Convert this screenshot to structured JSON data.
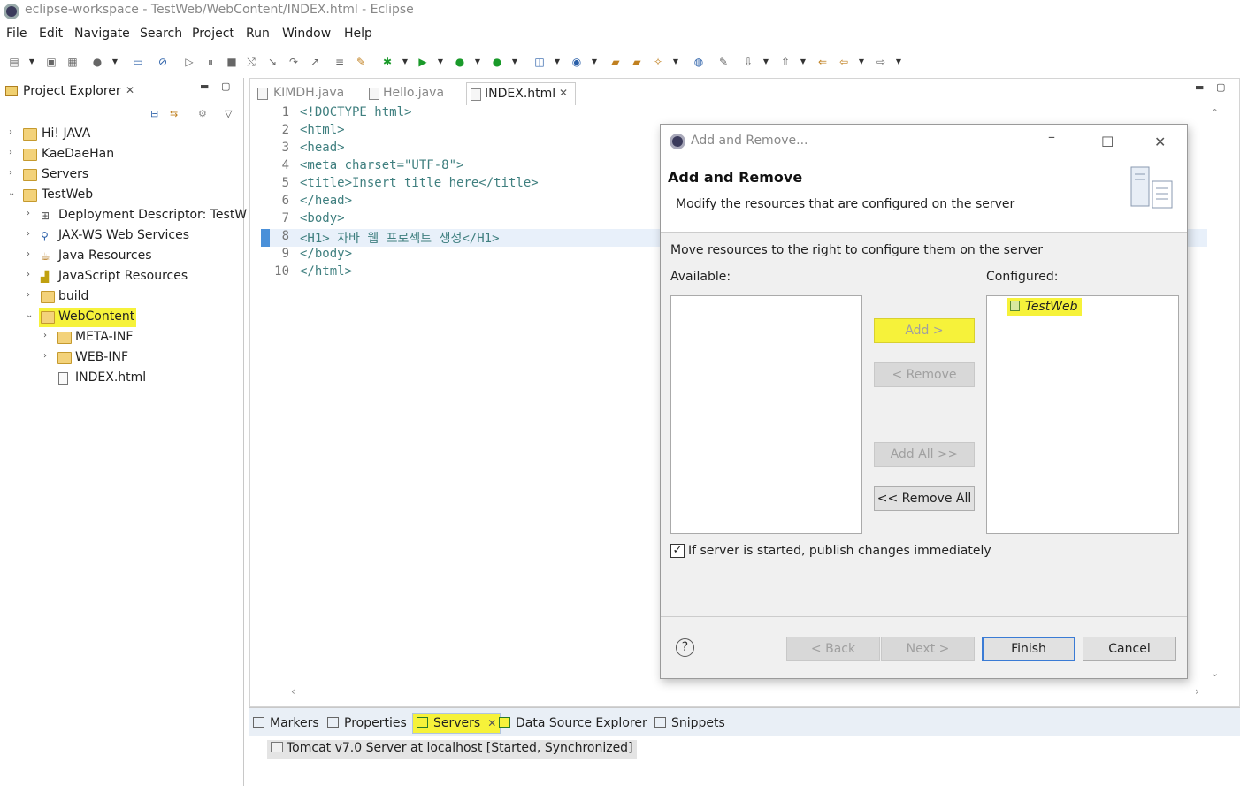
{
  "window": {
    "title": "eclipse-workspace - TestWeb/WebContent/INDEX.html - Eclipse"
  },
  "menu": [
    "File",
    "Edit",
    "Navigate",
    "Search",
    "Project",
    "Run",
    "Window",
    "Help"
  ],
  "project_explorer": {
    "title": "Project Explorer",
    "items": [
      {
        "label": "Hi! JAVA"
      },
      {
        "label": "KaeDaeHan"
      },
      {
        "label": "Servers"
      },
      {
        "label": "TestWeb"
      },
      {
        "label": "Deployment Descriptor: TestW"
      },
      {
        "label": "JAX-WS Web Services"
      },
      {
        "label": "Java Resources"
      },
      {
        "label": "JavaScript Resources"
      },
      {
        "label": "build"
      },
      {
        "label": "WebContent"
      },
      {
        "label": "META-INF"
      },
      {
        "label": "WEB-INF"
      },
      {
        "label": "INDEX.html"
      }
    ]
  },
  "editor": {
    "tabs": [
      "KIMDH.java",
      "Hello.java",
      "INDEX.html"
    ],
    "line_numbers": [
      "1",
      "2",
      "3",
      "4",
      "5",
      "6",
      "7",
      "8",
      "9",
      "10"
    ],
    "lines": [
      "<!DOCTYPE html>",
      "<html>",
      "<head>",
      "<meta charset=\"UTF-8\">",
      "<title>Insert title here</title>",
      "</head>",
      "<body>",
      "<H1> 자바 웹 프로젝트 생성</H1>",
      "</body>",
      "</html>"
    ]
  },
  "bottom": {
    "tabs": [
      "Markers",
      "Properties",
      "Servers",
      "Data Source Explorer",
      "Snippets"
    ],
    "server_entry": "Tomcat v7.0 Server at localhost   [Started, Synchronized]"
  },
  "dialog": {
    "title": "Add and Remove...",
    "heading": "Add and Remove",
    "description": "Modify the resources that are configured on the server",
    "instruction": "Move resources to the right to configure them on the server",
    "available_label": "Available:",
    "configured_label": "Configured:",
    "configured_items": [
      "TestWeb"
    ],
    "add_button": "Add >",
    "remove_button": "< Remove",
    "add_all_button": "Add All >>",
    "remove_all_button": "<< Remove All",
    "publish_checkbox": "If server is started, publish changes immediately",
    "publish_checked": true,
    "help": "?",
    "back_button": "< Back",
    "next_button": "Next >",
    "finish_button": "Finish",
    "cancel_button": "Cancel"
  }
}
